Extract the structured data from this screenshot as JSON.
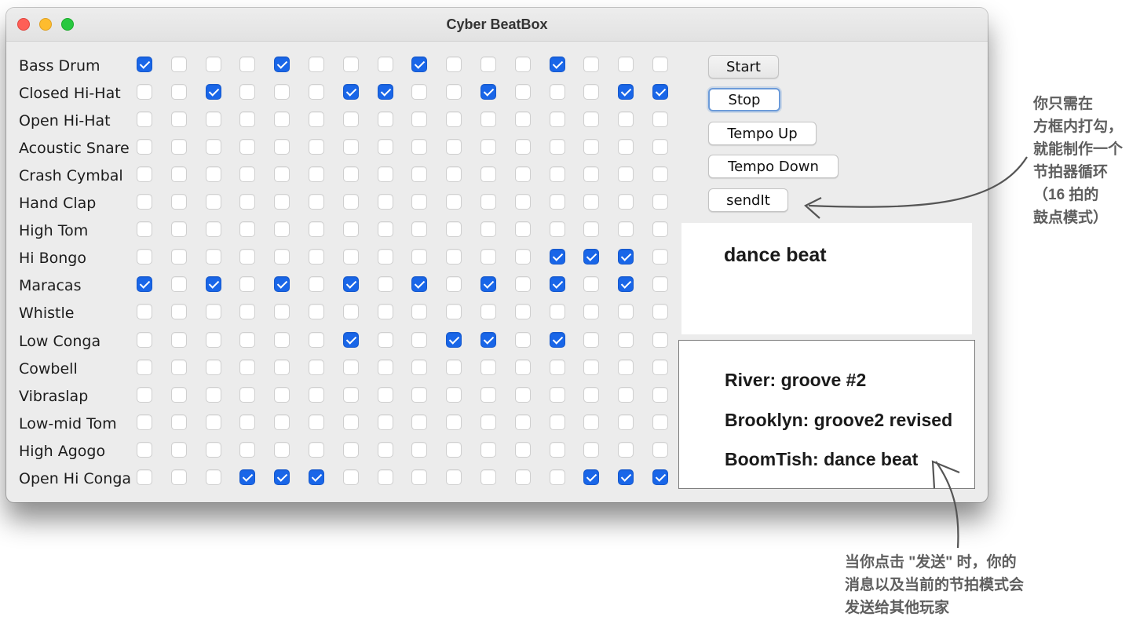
{
  "window": {
    "title": "Cyber BeatBox"
  },
  "instruments": [
    {
      "name": "Bass Drum",
      "checks": [
        1,
        0,
        0,
        0,
        1,
        0,
        0,
        0,
        1,
        0,
        0,
        0,
        1,
        0,
        0,
        0
      ]
    },
    {
      "name": "Closed Hi-Hat",
      "checks": [
        0,
        0,
        1,
        0,
        0,
        0,
        1,
        1,
        0,
        0,
        1,
        0,
        0,
        0,
        1,
        1
      ]
    },
    {
      "name": "Open Hi-Hat",
      "checks": [
        0,
        0,
        0,
        0,
        0,
        0,
        0,
        0,
        0,
        0,
        0,
        0,
        0,
        0,
        0,
        0
      ]
    },
    {
      "name": "Acoustic Snare",
      "checks": [
        0,
        0,
        0,
        0,
        0,
        0,
        0,
        0,
        0,
        0,
        0,
        0,
        0,
        0,
        0,
        0
      ]
    },
    {
      "name": "Crash Cymbal",
      "checks": [
        0,
        0,
        0,
        0,
        0,
        0,
        0,
        0,
        0,
        0,
        0,
        0,
        0,
        0,
        0,
        0
      ]
    },
    {
      "name": "Hand Clap",
      "checks": [
        0,
        0,
        0,
        0,
        0,
        0,
        0,
        0,
        0,
        0,
        0,
        0,
        0,
        0,
        0,
        0
      ]
    },
    {
      "name": "High Tom",
      "checks": [
        0,
        0,
        0,
        0,
        0,
        0,
        0,
        0,
        0,
        0,
        0,
        0,
        0,
        0,
        0,
        0
      ]
    },
    {
      "name": "Hi Bongo",
      "checks": [
        0,
        0,
        0,
        0,
        0,
        0,
        0,
        0,
        0,
        0,
        0,
        0,
        1,
        1,
        1,
        0
      ]
    },
    {
      "name": "Maracas",
      "checks": [
        1,
        0,
        1,
        0,
        1,
        0,
        1,
        0,
        1,
        0,
        1,
        0,
        1,
        0,
        1,
        0
      ]
    },
    {
      "name": "Whistle",
      "checks": [
        0,
        0,
        0,
        0,
        0,
        0,
        0,
        0,
        0,
        0,
        0,
        0,
        0,
        0,
        0,
        0
      ]
    },
    {
      "name": "Low Conga",
      "checks": [
        0,
        0,
        0,
        0,
        0,
        0,
        1,
        0,
        0,
        1,
        1,
        0,
        1,
        0,
        0,
        0
      ]
    },
    {
      "name": "Cowbell",
      "checks": [
        0,
        0,
        0,
        0,
        0,
        0,
        0,
        0,
        0,
        0,
        0,
        0,
        0,
        0,
        0,
        0
      ]
    },
    {
      "name": "Vibraslap",
      "checks": [
        0,
        0,
        0,
        0,
        0,
        0,
        0,
        0,
        0,
        0,
        0,
        0,
        0,
        0,
        0,
        0
      ]
    },
    {
      "name": "Low-mid Tom",
      "checks": [
        0,
        0,
        0,
        0,
        0,
        0,
        0,
        0,
        0,
        0,
        0,
        0,
        0,
        0,
        0,
        0
      ]
    },
    {
      "name": "High Agogo",
      "checks": [
        0,
        0,
        0,
        0,
        0,
        0,
        0,
        0,
        0,
        0,
        0,
        0,
        0,
        0,
        0,
        0
      ]
    },
    {
      "name": "Open Hi Conga",
      "checks": [
        0,
        0,
        0,
        1,
        1,
        1,
        0,
        0,
        0,
        0,
        0,
        0,
        0,
        1,
        1,
        1
      ]
    }
  ],
  "controls": {
    "start": "Start",
    "stop": "Stop",
    "tempo_up": "Tempo Up",
    "tempo_down": "Tempo Down",
    "send": "sendIt"
  },
  "message_input": {
    "value": "dance beat"
  },
  "incoming": [
    "River: groove #2",
    "Brooklyn: groove2 revised",
    "BoomTish: dance beat"
  ],
  "callouts": {
    "right": [
      "你只需在",
      "方框内打勾，",
      "就能制作一个",
      "节拍器循环",
      "（16 拍的",
      "鼓点模式）"
    ],
    "bottom": [
      "当你点击 \"发送\" 时，你的",
      "消息以及当前的节拍模式会",
      "发送给其他玩家"
    ]
  },
  "colors": {
    "check_on": "#1966e8",
    "close": "#fe5f57",
    "minimize": "#febc2e",
    "maximize": "#28c840",
    "annotation": "#5e5e5e"
  }
}
